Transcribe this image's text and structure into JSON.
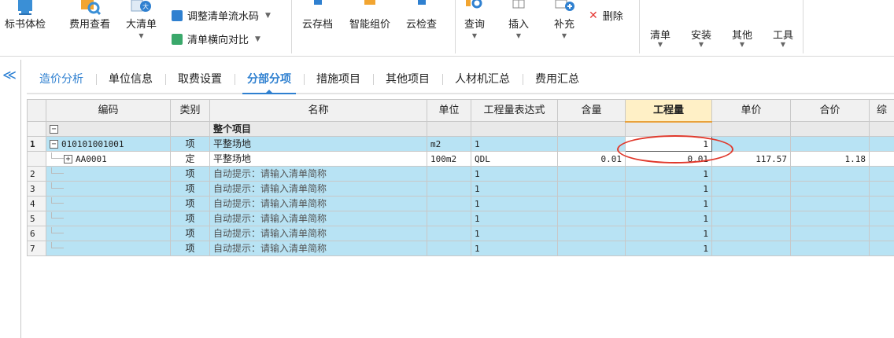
{
  "toolbar": {
    "biaoshu": "标书体检",
    "feiyong": "费用查看",
    "daqingdan": "大清单",
    "tiaozheng": "调整清单流水码",
    "hengxiang": "清单横向对比",
    "yuncundang": "云存档",
    "zhinengzujia": "智能组价",
    "yunjiancha": "云检查",
    "chaxun": "查询",
    "charu": "插入",
    "buchong": "补充",
    "shanchu": "删除",
    "qingdan_menu": "清单",
    "anzhuang_menu": "安装",
    "qita_menu": "其他",
    "gongju_menu": "工具"
  },
  "collapse_glyph": "≪",
  "tabs": [
    "造价分析",
    "单位信息",
    "取费设置",
    "分部分项",
    "措施项目",
    "其他项目",
    "人材机汇总",
    "费用汇总"
  ],
  "active_tab": "分部分项",
  "columns": [
    "编码",
    "类别",
    "名称",
    "单位",
    "工程量表达式",
    "含量",
    "工程量",
    "单价",
    "合价",
    "综"
  ],
  "rows": [
    {
      "rn": "",
      "code": "",
      "type": "",
      "name": "整个项目",
      "unit": "",
      "expr": "",
      "content": "",
      "qty": "",
      "price": "",
      "total": ""
    },
    {
      "rn": "1",
      "code": "010101001001",
      "type": "项",
      "name": "平整场地",
      "unit": "m2",
      "expr": "1",
      "content": "",
      "qty": "1",
      "price": "",
      "total": ""
    },
    {
      "rn": "",
      "code": "AA0001",
      "type": "定",
      "name": "平整场地",
      "unit": "100m2",
      "expr": "QDL",
      "content": "0.01",
      "qty": "0.01",
      "price": "117.57",
      "total": "1.18"
    },
    {
      "rn": "2",
      "code": "",
      "type": "项",
      "name": "自动提示：请输入清单简称",
      "unit": "",
      "expr": "1",
      "content": "",
      "qty": "1",
      "price": "",
      "total": ""
    },
    {
      "rn": "3",
      "code": "",
      "type": "项",
      "name": "自动提示：请输入清单简称",
      "unit": "",
      "expr": "1",
      "content": "",
      "qty": "1",
      "price": "",
      "total": ""
    },
    {
      "rn": "4",
      "code": "",
      "type": "项",
      "name": "自动提示：请输入清单简称",
      "unit": "",
      "expr": "1",
      "content": "",
      "qty": "1",
      "price": "",
      "total": ""
    },
    {
      "rn": "5",
      "code": "",
      "type": "项",
      "name": "自动提示：请输入清单简称",
      "unit": "",
      "expr": "1",
      "content": "",
      "qty": "1",
      "price": "",
      "total": ""
    },
    {
      "rn": "6",
      "code": "",
      "type": "项",
      "name": "自动提示：请输入清单简称",
      "unit": "",
      "expr": "1",
      "content": "",
      "qty": "1",
      "price": "",
      "total": ""
    },
    {
      "rn": "7",
      "code": "",
      "type": "项",
      "name": "自动提示：请输入清单简称",
      "unit": "",
      "expr": "1",
      "content": "",
      "qty": "1",
      "price": "",
      "total": ""
    }
  ],
  "colors": {
    "accent": "#2f80d0",
    "row_blue": "#b8e3f4",
    "header_highlight": "#fff0c6",
    "annotation_red": "#e0382b",
    "delete_red": "#e53935"
  }
}
